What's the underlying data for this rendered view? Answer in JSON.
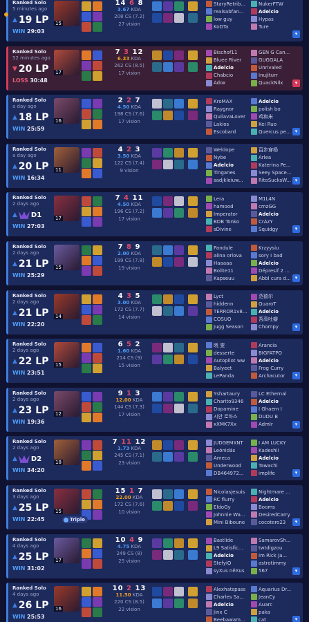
{
  "colors": {
    "win_accent": "#3f7ee0",
    "loss_accent": "#d63a5a",
    "background": "#0f1230",
    "gold": "#f0a020"
  },
  "icons": {
    "expand": "chevron-down-icon",
    "rank": "rank-emblem-icon"
  },
  "matches": [
    {
      "result": "win",
      "queue": "Ranked Solo",
      "time_ago": "5 minutes ago",
      "lp": "19 LP",
      "rank_badge": "",
      "wl": "WIN",
      "duration": "29:03",
      "level": "15",
      "k": "14",
      "d": "6",
      "a": "8",
      "kda": "3.67",
      "cs": "208 CS (7.2)",
      "vision": "27 vision",
      "multikill": "",
      "team1": [
        "StaryRetrib...",
        "realsabfan...",
        "low guy",
        "KoDTa",
        ""
      ],
      "team2": [
        "NukerFTW",
        "Adelcio",
        "Hypas",
        "Ture",
        ""
      ]
    },
    {
      "result": "loss",
      "queue": "Ranked Solo",
      "time_ago": "52 minutes ago",
      "lp": "20 LP",
      "rank_badge": "",
      "wl": "LOSS",
      "duration": "30:48",
      "level": "17",
      "k": "7",
      "d": "3",
      "a": "12",
      "kda": "6.33",
      "cs": "262 CS (8.5)",
      "vision": "17 vision",
      "multikill": "",
      "team1": [
        "Bischof11",
        "Bluee River",
        "Adelcio",
        "Chabcio",
        "Ádox"
      ],
      "team2": [
        "GEN G Can...",
        "GUGGALA",
        "Unrivaled",
        "Inujiturr",
        "QuackNilx"
      ]
    },
    {
      "result": "win",
      "queue": "Ranked Solo",
      "time_ago": "a day ago",
      "lp": "18 LP",
      "rank_badge": "",
      "wl": "WIN",
      "duration": "25:59",
      "level": "16",
      "k": "2",
      "d": "2",
      "a": "7",
      "kda": "4.50",
      "cs": "198 CS (7.6)",
      "vision": "17 vision",
      "multikill": "",
      "team1": [
        "KroMAX",
        "Raygnor",
        "QuilavaLover",
        "Lakios",
        "Escobard"
      ],
      "team2": [
        "Adelcio",
        "polish bo",
        "鸡和米",
        "Kei Ruo",
        "Quercus pe..."
      ]
    },
    {
      "result": "win",
      "queue": "Ranked Solo",
      "time_ago": "a day ago",
      "lp": "20 LP",
      "rank_badge": "",
      "wl": "WIN",
      "duration": "16:34",
      "level": "11",
      "k": "4",
      "d": "2",
      "a": "3",
      "kda": "3.50",
      "cs": "122 CS (7.4)",
      "vision": "9 vision",
      "multikill": "",
      "team1": [
        "Weldope",
        "Nybe",
        "Adelcio",
        "Tinganes",
        "sadjkleiuw..."
      ],
      "team2": [
        "百步穿杨",
        "Arlea",
        "Katerina Pe...",
        "Seey Space...",
        "RitoSucksW..."
      ]
    },
    {
      "result": "win",
      "queue": "Ranked Solo",
      "time_ago": "2 days ago",
      "lp": "",
      "rank_badge": "D1",
      "wl": "WIN",
      "duration": "27:03",
      "level": "17",
      "k": "7",
      "d": "4",
      "a": "11",
      "kda": "4.50",
      "cs": "196 CS (7.2)",
      "vision": "17 vision",
      "multikill": "",
      "team1": [
        "Lera",
        "hamood",
        "Imperator",
        "BDB Tonko",
        "sDivine"
      ],
      "team2": [
        "M1L4N",
        "cmzGG",
        "Adelcio",
        "CrÄzY",
        "Squidgy"
      ]
    },
    {
      "result": "win",
      "queue": "Ranked Solo",
      "time_ago": "2 days ago",
      "lp": "21 LP",
      "rank_badge": "",
      "wl": "WIN",
      "duration": "25:29",
      "level": "15",
      "k": "7",
      "d": "8",
      "a": "9",
      "kda": "2.00",
      "cs": "199 CS (7.8)",
      "vision": "19 vision",
      "multikill": "",
      "team1": [
        "Pandule",
        "alina orlova",
        "Haaaaa",
        "Bolite11",
        "Kapseuu"
      ],
      "team2": [
        "Krzyysiu",
        "sory I bad",
        "Adelcio",
        "Dépresif 2 ...",
        "Abbl cura d..."
      ]
    },
    {
      "result": "win",
      "queue": "Ranked Solo",
      "time_ago": "2 days ago",
      "lp": "21 LP",
      "rank_badge": "",
      "wl": "WIN",
      "duration": "22:20",
      "level": "14",
      "k": "4",
      "d": "3",
      "a": "5",
      "kda": "3.00",
      "cs": "172 CS (7.7)",
      "vision": "14 vision",
      "multikill": "",
      "team1": [
        "Lyct",
        "hiddenn",
        "TERROR1v8...",
        "COSUO",
        "Jugg Season"
      ],
      "team2": [
        "范德尔",
        "QuaroT",
        "Adelcio",
        "吾高吐瓣",
        "Chompy"
      ]
    },
    {
      "result": "win",
      "queue": "Ranked Solo",
      "time_ago": "2 days ago",
      "lp": "22 LP",
      "rank_badge": "",
      "wl": "WIN",
      "duration": "23:51",
      "level": "15",
      "k": "6",
      "d": "5",
      "a": "2",
      "kda": "1.60",
      "cs": "214 CS (9)",
      "vision": "15 vision",
      "multikill": "",
      "team1": [
        "晓 雯",
        "desserte",
        "Autopilot ww",
        "Balyeet",
        "LePanda"
      ],
      "team2": [
        "Arancia",
        "BIGFATPO",
        "Adelcio",
        "Frog Curry",
        "Archacutor"
      ]
    },
    {
      "result": "win",
      "queue": "Ranked Solo",
      "time_ago": "2 days ago",
      "lp": "23 LP",
      "rank_badge": "",
      "wl": "WIN",
      "duration": "19:36",
      "level": "12",
      "k": "9",
      "d": "1",
      "a": "3",
      "kda": "12.00",
      "cs": "144 CS (7.3)",
      "vision": "17 vision",
      "multikill": "",
      "team1": [
        "Yshartaury",
        "Charito9346",
        "Dopamine",
        "시안 로하스",
        "xXMK7Xx"
      ],
      "team2": [
        "LC Ethernal",
        "Adelcio",
        "I Ghaem I",
        "DUDU B",
        "Admlr"
      ]
    },
    {
      "result": "win",
      "queue": "Ranked Solo",
      "time_ago": "2 days ago",
      "lp": "",
      "rank_badge": "D2",
      "wl": "WIN",
      "duration": "34:20",
      "level": "18",
      "k": "7",
      "d": "11",
      "a": "12",
      "kda": "1.73",
      "cs": "245 CS (7.1)",
      "vision": "23 vision",
      "multikill": "",
      "team1": [
        "JUDGEMXNT",
        "Leónidás",
        "Ameca",
        "Underwood",
        "DB464972..."
      ],
      "team2": [
        "I AM LUCKY",
        "Kadeshii",
        "Adelcio",
        "Tawachi",
        "implife"
      ]
    },
    {
      "result": "win",
      "queue": "Ranked Solo",
      "time_ago": "3 days ago",
      "lp": "25 LP",
      "rank_badge": "",
      "wl": "WIN",
      "duration": "22:45",
      "level": "15",
      "k": "15",
      "d": "1",
      "a": "7",
      "kda": "22.00",
      "cs": "172 CS (7.6)",
      "vision": "10 vision",
      "multikill": "Triple",
      "team1": [
        "Nicolasjesuis",
        "RC flurry",
        "EldoGy",
        "Johnnie Wa...",
        "Mini Biboune"
      ],
      "team2": [
        "Nightmare ...",
        "Adelcio",
        "Booms",
        "DesiredCarry",
        "cocotero23"
      ]
    },
    {
      "result": "win",
      "queue": "Ranked Solo",
      "time_ago": "4 days ago",
      "lp": "25 LP",
      "rank_badge": "",
      "wl": "WIN",
      "duration": "31:02",
      "level": "17",
      "k": "10",
      "d": "4",
      "a": "9",
      "kda": "4.75",
      "cs": "249 CS (8)",
      "vision": "25 vision",
      "multikill": "",
      "team1": [
        "Bastlide",
        "L9 Satisfic...",
        "Adelcio",
        "StefyiQ",
        "syXus nêXus"
      ],
      "team2": [
        "SamarovSh...",
        "twtdigzou",
        "Im Rick Ja...",
        "astrotimmy",
        "567"
      ]
    },
    {
      "result": "win",
      "queue": "Ranked Solo",
      "time_ago": "4 days ago",
      "lp": "26 LP",
      "rank_badge": "",
      "wl": "WIN",
      "duration": "25:53",
      "level": "16",
      "k": "10",
      "d": "2",
      "a": "13",
      "kda": "11.50",
      "cs": "220 CS (8.5)",
      "vision": "22 vision",
      "multikill": "",
      "team1": [
        "Alexhatspass",
        "Charles Sa...",
        "Adelcio",
        "Jinx C",
        "Beebawam..."
      ],
      "team2": [
        "Aquarius Dr...",
        "JeanCy",
        "Auarc",
        "paka",
        "cat"
      ]
    }
  ]
}
